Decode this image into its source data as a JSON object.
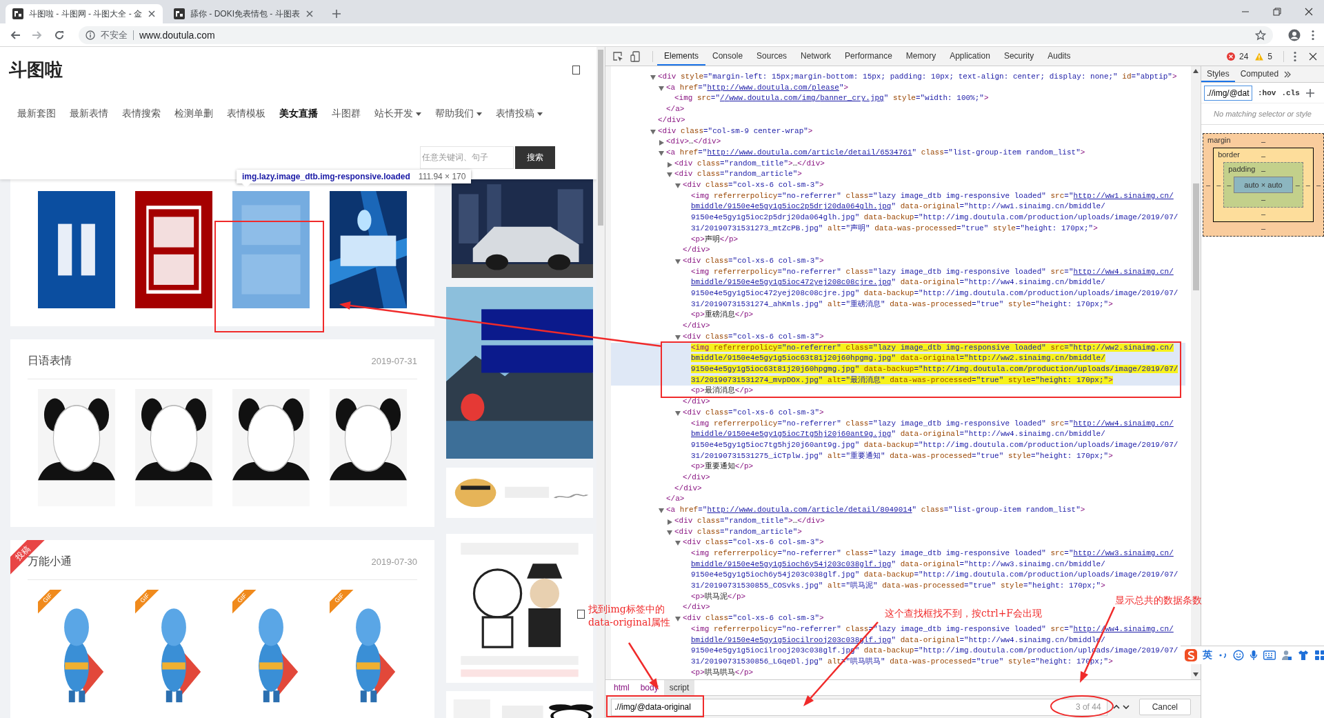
{
  "browser": {
    "tabs": [
      {
        "title": "斗图啦 - 斗图网 - 斗图大全 - 金",
        "selected": true
      },
      {
        "title": "舔你 - DOKI免表情包 - 斗图表",
        "selected": false
      }
    ],
    "security": "不安全",
    "url": "www.doutula.com"
  },
  "site": {
    "logo": "斗图啦",
    "nav": [
      {
        "label": "最新套图",
        "selected": false,
        "dropdown": false
      },
      {
        "label": "最新表情",
        "selected": false,
        "dropdown": false
      },
      {
        "label": "表情搜索",
        "selected": false,
        "dropdown": false
      },
      {
        "label": "检测单删",
        "selected": false,
        "dropdown": false
      },
      {
        "label": "表情模板",
        "selected": false,
        "dropdown": false
      },
      {
        "label": "美女直播",
        "selected": true,
        "dropdown": false
      },
      {
        "label": "斗图群",
        "selected": false,
        "dropdown": false
      },
      {
        "label": "站长开发",
        "selected": false,
        "dropdown": true
      },
      {
        "label": "帮助我们",
        "selected": false,
        "dropdown": true
      },
      {
        "label": "表情投稿",
        "selected": false,
        "dropdown": true
      }
    ],
    "search": {
      "placeholder": "任意关键词、句子",
      "button": "搜索"
    },
    "inspect_tooltip": {
      "selector": "img.lazy.image_dtb.img-responsive.loaded",
      "size": "111.94 × 170"
    },
    "cards": [
      {
        "images": [
          {
            "kind": "picture",
            "highlighted": false
          },
          {
            "kind": "picture",
            "highlighted": false
          },
          {
            "kind": "picture",
            "highlighted": true
          },
          {
            "kind": "picture",
            "highlighted": false
          }
        ]
      },
      {
        "title": "日语表情",
        "date": "2019-07-31",
        "images": [
          {
            "kind": "picture",
            "highlighted": false
          },
          {
            "kind": "picture",
            "highlighted": false
          },
          {
            "kind": "picture",
            "highlighted": false
          },
          {
            "kind": "picture",
            "highlighted": false
          }
        ]
      },
      {
        "ribbon": "投稿",
        "title": "万能小通",
        "date": "2019-07-30",
        "images": [
          {
            "kind": "picture",
            "badge": "GIF",
            "highlighted": false
          },
          {
            "kind": "picture",
            "badge": "GIF",
            "highlighted": false
          },
          {
            "kind": "picture",
            "badge": "GIF",
            "highlighted": false
          },
          {
            "kind": "picture",
            "badge": "GIF",
            "highlighted": false
          }
        ]
      }
    ],
    "ads": [
      {
        "kind": "picture"
      },
      {
        "kind": "picture"
      },
      {
        "kind": "picture"
      },
      {
        "kind": "picture"
      },
      {
        "kind": "picture"
      }
    ]
  },
  "devtools": {
    "tabs": [
      {
        "label": "Elements",
        "selected": true
      },
      {
        "label": "Console",
        "selected": false
      },
      {
        "label": "Sources",
        "selected": false
      },
      {
        "label": "Network",
        "selected": false
      },
      {
        "label": "Performance",
        "selected": false
      },
      {
        "label": "Memory",
        "selected": false
      },
      {
        "label": "Application",
        "selected": false
      },
      {
        "label": "Security",
        "selected": false
      },
      {
        "label": "Audits",
        "selected": false
      }
    ],
    "errors": "24",
    "warnings": "5",
    "dom": [
      {
        "segs": [
          "<div style=\"margin-left: 15px;margin-bottom: 15px; padding: 10px; text-align: center; display: none;\" id=\"abptip\">"
        ],
        "selected": false,
        "expanded": true,
        "children": [
          {
            "segs": [
              "<a href=\"",
              {
                "link": "http://www.doutula.com/please"
              },
              "\">"
            ],
            "selected": false,
            "expanded": true,
            "children": [
              {
                "segs": [
                  "<img src=\"",
                  {
                    "link": "//www.doutula.com/img/banner_cry.jpg"
                  },
                  "\" style=\"width: 100%;\">"
                ],
                "selected": false
              }
            ],
            "close": [
              "</a>"
            ]
          }
        ],
        "close": [
          "</div>"
        ]
      },
      {
        "segs": [
          "<div class=\"col-sm-9 center-wrap\">"
        ],
        "selected": false,
        "expanded": true,
        "children": [
          {
            "segs": [
              "<div>…</div>"
            ],
            "selected": false,
            "expanded": false
          },
          {
            "segs": [
              "<a href=\"",
              {
                "link": "http://www.doutula.com/article/detail/6534761"
              },
              "\" class=\"list-group-item random_list\">"
            ],
            "selected": false,
            "expanded": true,
            "children": [
              {
                "segs": [
                  "<div class=\"random_title\">…</div>"
                ],
                "selected": false,
                "expanded": false
              },
              {
                "segs": [
                  "<div class=\"random_article\">"
                ],
                "selected": false,
                "expanded": true,
                "children": [
                  {
                    "segs": [
                      "<div class=\"col-xs-6 col-sm-3\">"
                    ],
                    "selected": false,
                    "expanded": true,
                    "children": [
                      {
                        "segs": [
                          "<img referrerpolicy=\"no-referrer\" class=\"lazy image_dtb img-responsive loaded\" src=\"",
                          {
                            "link": "http://ww1.sinaimg.cn/bmiddle/9150e4e5gy1g5ioc2p5drj20da064glh.jpg"
                          },
                          "\" data-original=\"http://ww1.sinaimg.cn/bmiddle/9150e4e5gy1g5ioc2p5drj20da064glh.jpg\" data-backup=\"http://img.doutula.com/production/uploads/image/2019/07/31/20190731531273_mtZcPB.jpg\" alt=\"声明\" data-was-processed=\"true\" style=\"height: 170px;\">"
                        ],
                        "selected": false
                      },
                      {
                        "segs": [
                          "<p>声明</p>"
                        ],
                        "selected": false
                      }
                    ],
                    "close": [
                      "</div>"
                    ]
                  },
                  {
                    "segs": [
                      "<div class=\"col-xs-6 col-sm-3\">"
                    ],
                    "selected": false,
                    "expanded": true,
                    "children": [
                      {
                        "segs": [
                          "<img referrerpolicy=\"no-referrer\" class=\"lazy image_dtb img-responsive loaded\" src=\"",
                          {
                            "link": "http://ww4.sinaimg.cn/bmiddle/9150e4e5gy1g5ioc472yej208c08cjre.jpg"
                          },
                          "\" data-original=\"http://ww4.sinaimg.cn/bmiddle/9150e4e5gy1g5ioc472yej208c08cjre.jpg\" data-backup=\"http://img.doutula.com/production/uploads/image/2019/07/31/20190731531274_ahKmls.jpg\" alt=\"重磅消息\" data-was-processed=\"true\" style=\"height: 170px;\">"
                        ],
                        "selected": false
                      },
                      {
                        "segs": [
                          "<p>重磅消息</p>"
                        ],
                        "selected": false
                      }
                    ],
                    "close": [
                      "</div>"
                    ]
                  },
                  {
                    "segs": [
                      "<div class=\"col-xs-6 col-sm-3\">"
                    ],
                    "selected": false,
                    "expanded": true,
                    "children": [
                      {
                        "segs": [
                          "<img referrerpolicy=\"no-referrer\" class=\"lazy image_dtb img-responsive loaded\" src=\"http://ww2.sinaimg.cn/bmiddle/9150e4e5gy1g5ioc63t81j20j60hpgmg.jpg\" data-original=\"http://ww2.sinaimg.cn/bmiddle/9150e4e5gy1g5ioc63t81j20j60hpgmg.jpg\" data-backup=\"http://img.doutula.com/production/uploads/image/2019/07/31/20190731531274_mvpDOx.jpg\" alt=\"最消消息\" data-was-processed=\"true\" style=\"height: 170px;\">"
                        ],
                        "selected": true
                      },
                      {
                        "segs": [
                          "<p>最消消息</p>"
                        ],
                        "selected": false
                      }
                    ],
                    "close": [
                      "</div>"
                    ]
                  },
                  {
                    "segs": [
                      "<div class=\"col-xs-6 col-sm-3\">"
                    ],
                    "selected": false,
                    "expanded": true,
                    "children": [
                      {
                        "segs": [
                          "<img referrerpolicy=\"no-referrer\" class=\"lazy image_dtb img-responsive loaded\" src=\"",
                          {
                            "link": "http://ww4.sinaimg.cn/bmiddle/9150e4e5gy1g5ioc7tg5hj20j60ant9g.jpg"
                          },
                          "\" data-original=\"http://ww4.sinaimg.cn/bmiddle/9150e4e5gy1g5ioc7tg5hj20j60ant9g.jpg\" data-backup=\"http://img.doutula.com/production/uploads/image/2019/07/31/20190731531275_iCTplw.jpg\" alt=\"重要通知\" data-was-processed=\"true\" style=\"height: 170px;\">"
                        ],
                        "selected": false
                      },
                      {
                        "segs": [
                          "<p>重要通知</p>"
                        ],
                        "selected": false
                      }
                    ],
                    "close": [
                      "</div>"
                    ]
                  }
                ],
                "close": [
                  "</div>"
                ]
              }
            ],
            "close": [
              "</a>"
            ]
          },
          {
            "segs": [
              "<a href=\"",
              {
                "link": "http://www.doutula.com/article/detail/8049014"
              },
              "\" class=\"list-group-item random_list\">"
            ],
            "selected": false,
            "expanded": true,
            "children": [
              {
                "segs": [
                  "<div class=\"random_title\">…</div>"
                ],
                "selected": false,
                "expanded": false
              },
              {
                "segs": [
                  "<div class=\"random_article\">"
                ],
                "selected": false,
                "expanded": true,
                "children": [
                  {
                    "segs": [
                      "<div class=\"col-xs-6 col-sm-3\">"
                    ],
                    "selected": false,
                    "expanded": true,
                    "children": [
                      {
                        "segs": [
                          "<img referrerpolicy=\"no-referrer\" class=\"lazy image_dtb img-responsive loaded\" src=\"",
                          {
                            "link": "http://ww3.sinaimg.cn/bmiddle/9150e4e5gy1g5ioch6y54j203c038glf.jpg"
                          },
                          "\" data-original=\"http://ww3.sinaimg.cn/bmiddle/9150e4e5gy1g5ioch6y54j203c038glf.jpg\" data-backup=\"http://img.doutula.com/production/uploads/image/2019/07/31/20190731530855_COSvks.jpg\" alt=\"哄马泥\" data-was-processed=\"true\" style=\"height: 170px;\">"
                        ],
                        "selected": false
                      },
                      {
                        "segs": [
                          "<p>哄马泥</p>"
                        ],
                        "selected": false
                      }
                    ],
                    "close": [
                      "</div>"
                    ]
                  },
                  {
                    "segs": [
                      "<div class=\"col-xs-6 col-sm-3\">"
                    ],
                    "selected": false,
                    "expanded": true,
                    "children": [
                      {
                        "segs": [
                          "<img referrerpolicy=\"no-referrer\" class=\"lazy image_dtb img-responsive loaded\" src=\"",
                          {
                            "link": "http://ww4.sinaimg.cn/bmiddle/9150e4e5gy1g5iocilrooj203c038glf.jpg"
                          },
                          "\" data-original=\"http://ww4.sinaimg.cn/bmiddle/9150e4e5gy1g5iocilrooj203c038glf.jpg\" data-backup=\"http://img.doutula.com/production/uploads/image/2019/07/31/20190731530856_LGqeDl.jpg\" alt=\"哄马哄马\" data-was-processed=\"true\" style=\"height: 170px;\">"
                        ],
                        "selected": false
                      },
                      {
                        "segs": [
                          "<p>哄马哄马</p>"
                        ],
                        "selected": false
                      }
                    ]
                  }
                ]
              }
            ]
          }
        ]
      }
    ],
    "breadcrumbs": [
      {
        "label": "html",
        "selected": false
      },
      {
        "label": "body",
        "selected": false
      },
      {
        "label": "script",
        "selected": true
      }
    ],
    "search": {
      "value": ".//img/@data-original",
      "count": "3 of 44",
      "button": "Cancel"
    },
    "sidebar": {
      "tabs": [
        {
          "label": "Styles",
          "selected": true
        },
        {
          "label": "Computed",
          "selected": false
        }
      ],
      "filter": ".//img/@dat",
      "hov": ":hov",
      "cls": ".cls",
      "empty": "No matching selector or style",
      "box_model": {
        "margin": {
          "label": "margin",
          "dashes": [
            "–",
            "–",
            "–",
            "–"
          ]
        },
        "border": {
          "label": "border",
          "dashes": [
            "–",
            "–",
            "–",
            "–"
          ]
        },
        "padding": {
          "label": "padding",
          "dashes": [
            "–",
            "–",
            "–",
            "–"
          ]
        },
        "content": "auto × auto"
      }
    }
  },
  "ime": {
    "mode": "英"
  },
  "annotations": [
    "找到img标签中的data-original属性",
    "这个查找框找不到，按ctrl+F会出现",
    "显示总共的数据条数"
  ]
}
